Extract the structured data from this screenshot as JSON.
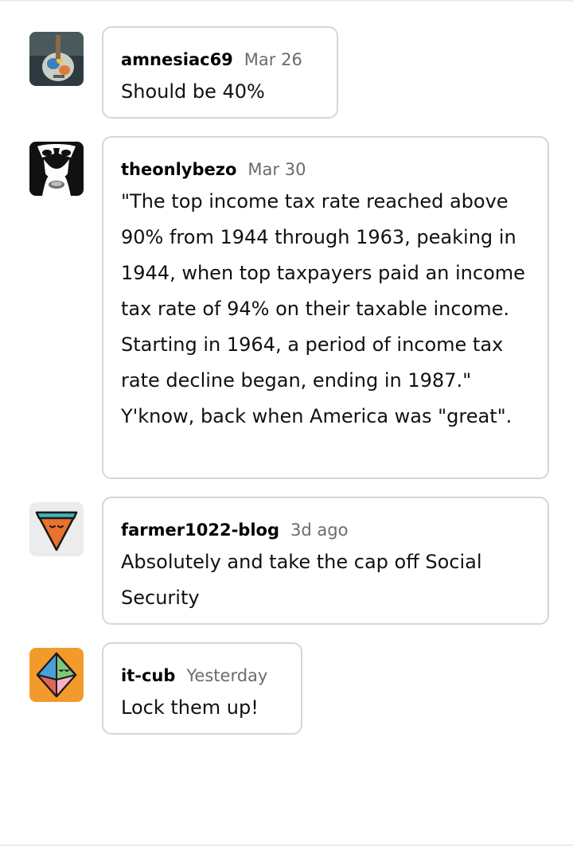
{
  "comments": [
    {
      "username": "amnesiac69",
      "timestamp": "Mar 26",
      "text": "Should be 40%",
      "avatar_icon": "guitar-photo-avatar-icon"
    },
    {
      "username": "theonlybezo",
      "timestamp": "Mar 30",
      "text": "\"The top income tax rate reached above 90% from 1944 through 1963, peaking in 1944, when top taxpayers paid an income tax rate of 94% on their taxable income. Starting in 1964, a period of income tax rate decline began, ending in 1987.\" Y'know, back when America was \"great\".",
      "avatar_icon": "face-paint-avatar-icon"
    },
    {
      "username": "farmer1022-blog",
      "timestamp": "3d ago",
      "text": "Absolutely and take the cap off Social Security",
      "avatar_icon": "pizza-slice-avatar-icon"
    },
    {
      "username": "it-cub",
      "timestamp": "Yesterday",
      "text": "Lock them up!",
      "avatar_icon": "gem-avatar-icon"
    }
  ],
  "colors": {
    "bubble_border": "#d6d6d6",
    "timestamp": "#6b6b6b",
    "avatar_gem_bg": "#f39a2c",
    "avatar_pizza_bg": "#ececec"
  }
}
